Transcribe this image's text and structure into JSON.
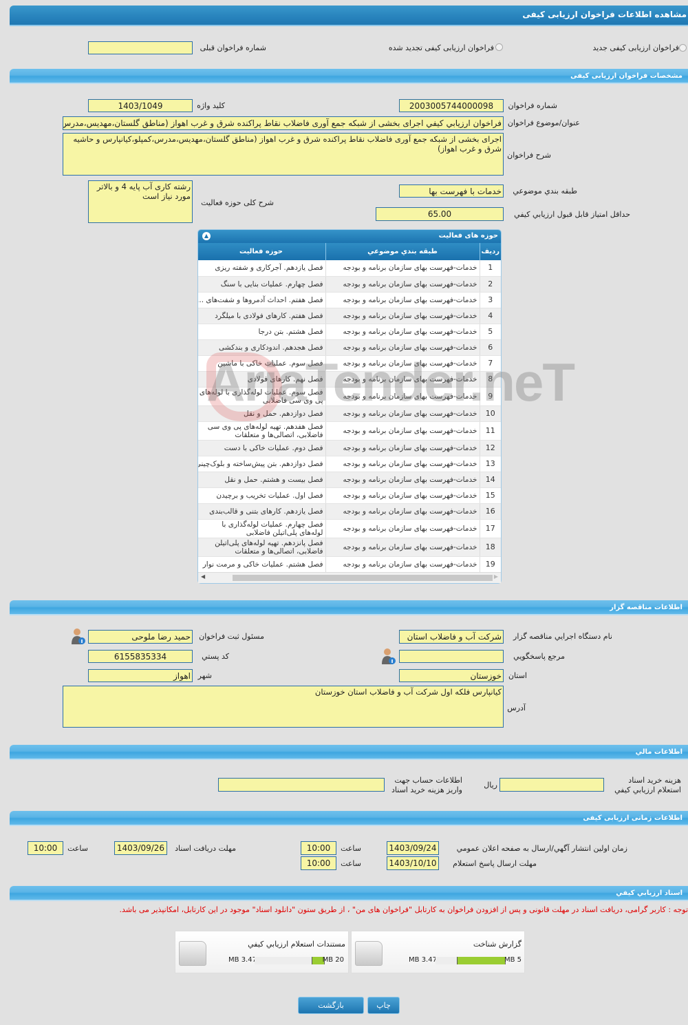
{
  "header": {
    "title": "مشاهده اطلاعات فراخوان ارزیابی کیفی"
  },
  "type": {
    "new_label": "فراخوان ارزیابی کیفی جدید",
    "renewed_label": "فراخوان ارزیابی کیفی تجدید شده",
    "prev_number_label": "شماره فراخوان قبلی",
    "prev_number": ""
  },
  "spec": {
    "section": "مشخصات فراخوان ارزیابی کیفی",
    "number_label": "شماره فراخوان",
    "number": "2003005744000098",
    "keyword_label": "کلید واژه",
    "keyword": "1403/1049",
    "title_label": "عنوان/موضوع فراخوان",
    "title": "فراخوان ارزيابي كيفي اجرای بخشی از شبکه جمع آوری فاضلاب نقاط پراکنده شرق و غرب اهواز (مناطق گلستان،مهدیس،مدرس،کمپلو،کیانپارس و حاشیه شرق و غرب اهواز)",
    "desc_label": "شرح فراخوان",
    "desc": "اجرای بخشی از شبکه جمع آوری فاضلاب نقاط پراکنده شرق و غرب اهواز (مناطق گلستان،مهدیس،مدرس،کمپلو،کیانپارس و حاشیه شرق و غرب اهواز)",
    "category_label": "طبقه بندي موضوعي",
    "category": "خدمات با فهرست بها",
    "activity_desc_label": "شرح کلی حوزه فعالیت",
    "activity_desc": "رشته کاری آب پایه 4 و بالاتر مورد نیاز است",
    "min_score_label": "حداقل امتياز قابل قبول ارزيابي کيفي",
    "min_score": "65.00"
  },
  "activities": {
    "title": "حوزه های فعالیت",
    "headers": [
      "رديف",
      "طبقه بندي موضوعي",
      "حوزه فعالیت"
    ],
    "rows": [
      [
        "1",
        "خدمات-فهرست بهای سازمان برنامه و بودجه",
        "فصل یازدهم. آجرکاری و شفته ریزی"
      ],
      [
        "2",
        "خدمات-فهرست بهای سازمان برنامه و بودجه",
        "فصل چهارم. عملیات بنایی با سنگ"
      ],
      [
        "3",
        "خدمات-فهرست بهای سازمان برنامه و بودجه",
        "فصل هفتم. احداث آدمروها و شفت‌های ..."
      ],
      [
        "4",
        "خدمات-فهرست بهای سازمان برنامه و بودجه",
        "فصل هفتم. کارهای فولادی با میلگرد"
      ],
      [
        "5",
        "خدمات-فهرست بهای سازمان برنامه و بودجه",
        "فصل هشتم. بتن درجا"
      ],
      [
        "6",
        "خدمات-فهرست بهای سازمان برنامه و بودجه",
        "فصل هجدهم. اندودکاری و بندکشی"
      ],
      [
        "7",
        "خدمات-فهرست بهای سازمان برنامه و بودجه",
        "فصل سوم. عملیات خاکی با ماشین"
      ],
      [
        "8",
        "خدمات-فهرست بهای سازمان برنامه و بودجه",
        "فصل نهم. کارهای فولادی"
      ],
      [
        "9",
        "خدمات-فهرست بهای سازمان برنامه و بودجه",
        "فصل سوم. عملیات لوله‌گذاری با لوله‌های پی وی سی فاضلابی"
      ],
      [
        "10",
        "خدمات-فهرست بهای سازمان برنامه و بودجه",
        "فصل دوازدهم. حمل و نقل"
      ],
      [
        "11",
        "خدمات-فهرست بهای سازمان برنامه و بودجه",
        "فصل هفدهم. تهیه لوله‌های پی وی سی فاضلابی، اتصالی‌ها و متعلقات"
      ],
      [
        "12",
        "خدمات-فهرست بهای سازمان برنامه و بودجه",
        "فصل دوم. عملیات خاکی با دست"
      ],
      [
        "13",
        "خدمات-فهرست بهای سازمان برنامه و بودجه",
        "فصل دوازدهم. بتن پیش‌ساخته و بلوک‌چینی"
      ],
      [
        "14",
        "خدمات-فهرست بهای سازمان برنامه و بودجه",
        "فصل بیست و هشتم. حمل و نقل"
      ],
      [
        "15",
        "خدمات-فهرست بهای سازمان برنامه و بودجه",
        "فصل اول. عملیات تخریب و برچیدن"
      ],
      [
        "16",
        "خدمات-فهرست بهای سازمان برنامه و بودجه",
        "فصل یازدهم. کارهای بتنی و قالب‌بندی"
      ],
      [
        "17",
        "خدمات-فهرست بهای سازمان برنامه و بودجه",
        "فصل چهارم. عملیات لوله‌گذاری با لوله‌های پلی‌اتیلن فاضلابی"
      ],
      [
        "18",
        "خدمات-فهرست بهای سازمان برنامه و بودجه",
        "فصل پانزدهم. تهیه لوله‌های پلی‌اتیلن فاضلابی، اتصالی‌ها و متعلقات"
      ],
      [
        "19",
        "خدمات-فهرست بهای سازمان برنامه و بودجه",
        "فصل هشتم. عملیات خاکی و مرمت نوار"
      ]
    ]
  },
  "org": {
    "section": "اطلاعات مناقصه گزار",
    "name_label": "نام دستگاه اجرايي مناقصه گزار",
    "name": "شرکت آب و فاضلاب استان",
    "responsible_label": "مسئول ثبت فراخوان",
    "responsible": "حمید رضا ملوحی",
    "ref_label": "مرجع پاسخگويي",
    "ref": "",
    "postal_label": "کد پستي",
    "postal": "6155835334",
    "province_label": "استان",
    "province": "خوزستان",
    "city_label": "شهر",
    "city": "اهواز",
    "address_label": "آدرس",
    "address": "کیانپارس فلکه اول شرکت آب و فاضلاب استان خوزستان"
  },
  "finance": {
    "section": "اطلاعات مالي",
    "fee_label_1": "هزينه خريد اسناد",
    "fee_label_2": "استعلام ارزيابي کيفي",
    "fee": "",
    "currency": "ريال",
    "account_label_1": "اطلاعات حساب جهت",
    "account_label_2": "واريز هزينه خريد اسناد",
    "account": ""
  },
  "timing": {
    "section": "اطلاعات زمانی ارزيابی کيفی",
    "publish_label": "زمان اولين انتشار آگهي/ارسال به صفحه اعلان عمومي",
    "publish_date": "1403/09/24",
    "publish_time": "10:00",
    "docs_label": "مهلت دريافت اسناد",
    "docs_date": "1403/09/26",
    "docs_time": "10:00",
    "reply_label": "مهلت ارسال پاسخ استعلام",
    "reply_date": "1403/10/10",
    "reply_time": "10:00",
    "time_label": "ساعت"
  },
  "documents": {
    "section": "اسناد ارزيابي کيفي",
    "notice": "توجه : کاربر گرامی، دریافت اسناد در مهلت قانونی و پس از افزودن فراخوان به کارتابل \"فراخوان های من\" ، از طریق ستون \"دانلود اسناد\" موجود در این کارتابل، امکانپذیر می باشد.",
    "files": [
      {
        "name": "گزارش شناخت",
        "size": "3.47 MB",
        "max": "5 MB",
        "fill_percent": 69.4
      },
      {
        "name": "مستندات استعلام ارزيابي کيفي",
        "size": "3.47 MB",
        "max": "20 MB",
        "fill_percent": 17.35
      }
    ]
  },
  "buttons": {
    "print": "چاپ",
    "back": "بازگشت"
  },
  "watermark": "AriaTender.neT",
  "colors": {
    "field_bg": "#f7f5a5",
    "header_blue": "#2a86bf",
    "notice_red": "#e00000",
    "progress_green": "#9acd32"
  }
}
